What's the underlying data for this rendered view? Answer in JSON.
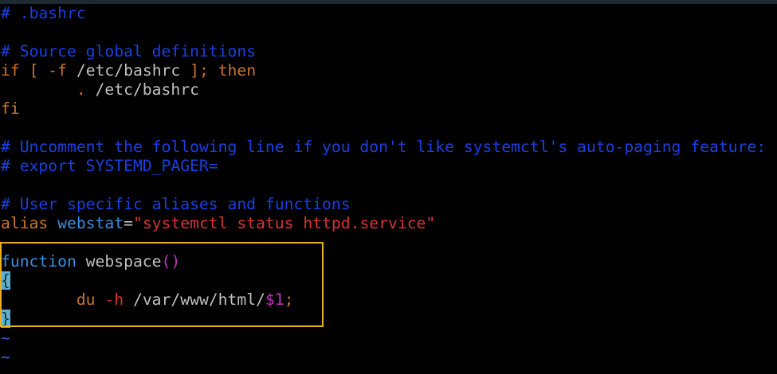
{
  "editor": {
    "lines": [
      {
        "segments": [
          {
            "cls": "c-comment",
            "text": "# .bashrc"
          }
        ]
      },
      {
        "segments": []
      },
      {
        "segments": [
          {
            "cls": "c-comment",
            "text": "# Source global definitions"
          }
        ]
      },
      {
        "segments": [
          {
            "cls": "c-kw",
            "text": "if"
          },
          {
            "cls": "c-plain",
            "text": " "
          },
          {
            "cls": "c-kw",
            "text": "["
          },
          {
            "cls": "c-plain",
            "text": " "
          },
          {
            "cls": "c-kw",
            "text": "-f"
          },
          {
            "cls": "c-plain",
            "text": " /etc/bashrc "
          },
          {
            "cls": "c-kw",
            "text": "];"
          },
          {
            "cls": "c-plain",
            "text": " "
          },
          {
            "cls": "c-kw",
            "text": "then"
          }
        ]
      },
      {
        "segments": [
          {
            "cls": "c-plain",
            "text": "        "
          },
          {
            "cls": "c-kw",
            "text": "."
          },
          {
            "cls": "c-plain",
            "text": " /etc/bashrc"
          }
        ]
      },
      {
        "segments": [
          {
            "cls": "c-kw",
            "text": "fi"
          }
        ]
      },
      {
        "segments": []
      },
      {
        "segments": [
          {
            "cls": "c-comment",
            "text": "# Uncomment the following line if you don't like systemctl's auto-paging feature:"
          }
        ]
      },
      {
        "segments": [
          {
            "cls": "c-comment",
            "text": "# export SYSTEMD_PAGER="
          }
        ]
      },
      {
        "segments": []
      },
      {
        "segments": [
          {
            "cls": "c-comment",
            "text": "# User specific aliases and functions"
          }
        ]
      },
      {
        "segments": [
          {
            "cls": "c-kw",
            "text": "alias"
          },
          {
            "cls": "c-plain",
            "text": " "
          },
          {
            "cls": "c-ident",
            "text": "webstat"
          },
          {
            "cls": "c-plain",
            "text": "="
          },
          {
            "cls": "c-str",
            "text": "\"systemctl status httpd.service\""
          }
        ]
      },
      {
        "segments": []
      },
      {
        "segments": [
          {
            "cls": "c-fn",
            "text": "function"
          },
          {
            "cls": "c-plain",
            "text": " webspace"
          },
          {
            "cls": "c-paren",
            "text": "()"
          }
        ]
      },
      {
        "segments": [
          {
            "cls": "brace",
            "text": "{"
          }
        ]
      },
      {
        "segments": [
          {
            "cls": "c-plain",
            "text": "        "
          },
          {
            "cls": "c-kw",
            "text": "du"
          },
          {
            "cls": "c-plain",
            "text": " "
          },
          {
            "cls": "c-str",
            "text": "-h"
          },
          {
            "cls": "c-plain",
            "text": " /var/www/html/"
          },
          {
            "cls": "c-var",
            "text": "$1"
          },
          {
            "cls": "c-kw",
            "text": ";"
          }
        ]
      },
      {
        "segments": [
          {
            "cls": "brace-close",
            "text": "}"
          }
        ]
      },
      {
        "segments": [
          {
            "cls": "c-tilde",
            "text": "~"
          }
        ]
      },
      {
        "segments": [
          {
            "cls": "c-tilde",
            "text": "~"
          }
        ]
      }
    ]
  },
  "colors": {
    "comment": "#1b3fe0",
    "keyword": "#c8742a",
    "string": "#d93333",
    "identifier": "#3a8fe0",
    "variable": "#c030c0",
    "highlight_border": "#e8b020",
    "cursor_brace_bg": "#5ab0d8"
  }
}
